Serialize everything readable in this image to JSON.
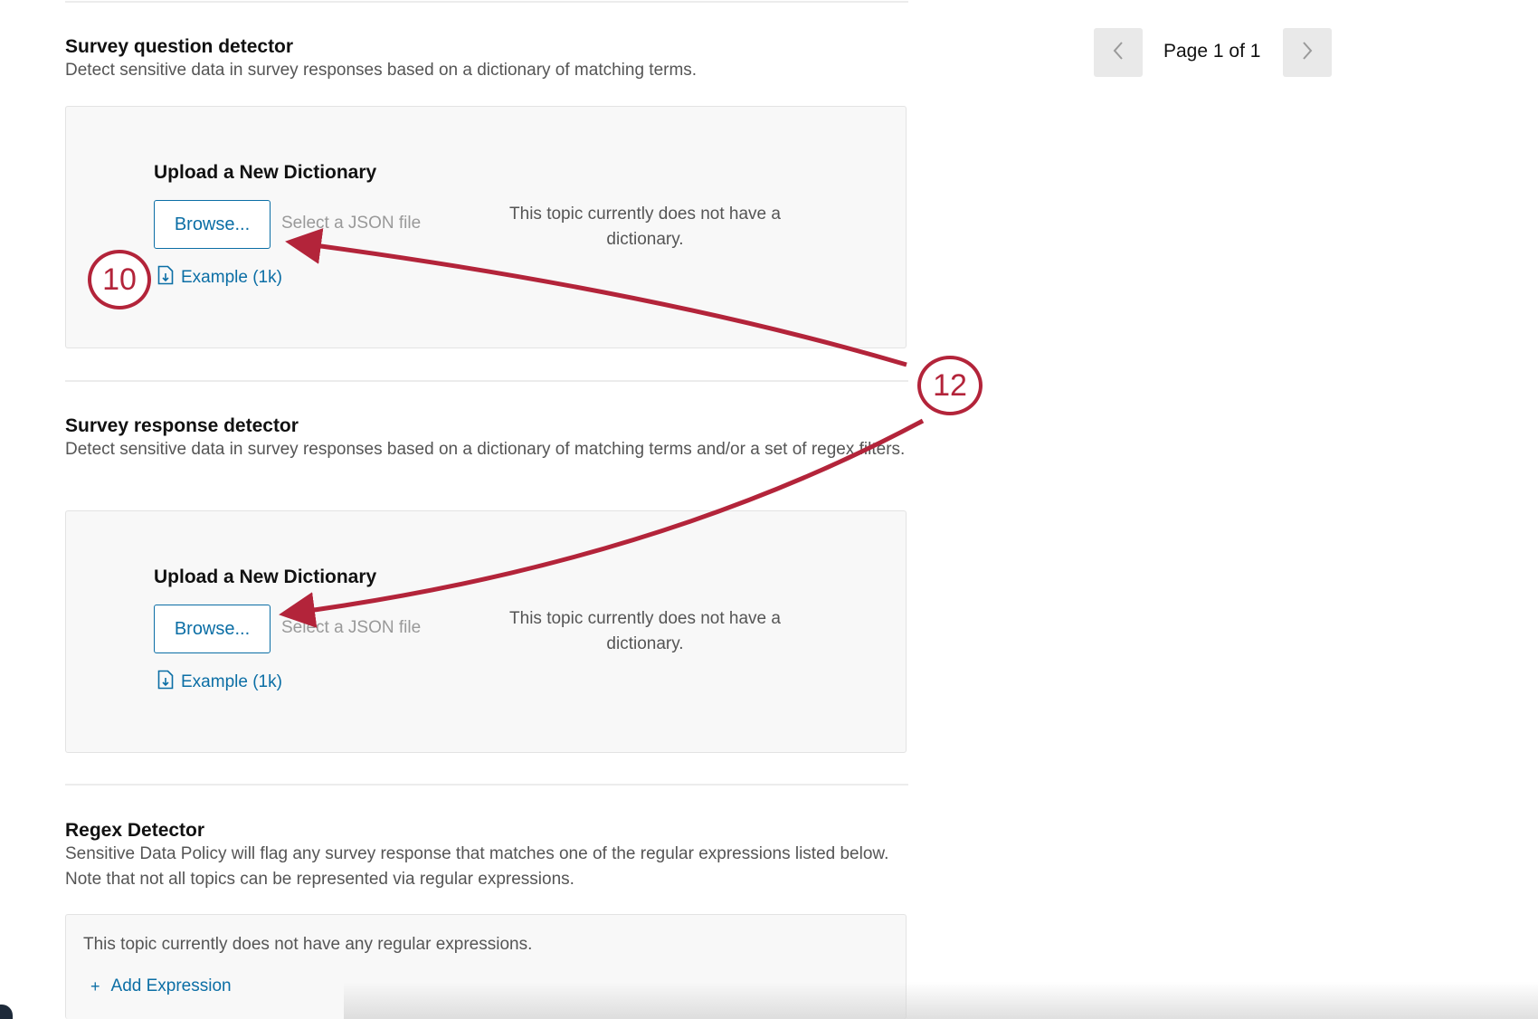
{
  "pagination": {
    "label": "Page 1 of 1",
    "prev_icon": "chevron-left-icon",
    "next_icon": "chevron-right-icon"
  },
  "question_detector": {
    "title": "Survey question detector",
    "description": "Detect sensitive data in survey responses based on a dictionary of matching terms.",
    "upload_title": "Upload a New Dictionary",
    "browse_label": "Browse...",
    "file_placeholder": "Select a JSON file",
    "no_dictionary": "This topic currently does not have a dictionary.",
    "example_link": "Example (1k)"
  },
  "response_detector": {
    "title": "Survey response detector",
    "description": "Detect sensitive data in survey responses based on a dictionary of matching terms and/or a set of regex filters.",
    "upload_title": "Upload a New Dictionary",
    "browse_label": "Browse...",
    "file_placeholder": "Select a JSON file",
    "no_dictionary": "This topic currently does not have a dictionary.",
    "example_link": "Example (1k)"
  },
  "regex_detector": {
    "title": "Regex Detector",
    "description": "Sensitive Data Policy will flag any survey response that matches one of the regular expressions listed below. Note that not all topics can be represented via regular expressions.",
    "empty_message": "This topic currently does not have any regular expressions.",
    "add_label": "Add Expression",
    "add_icon": "+"
  },
  "callouts": {
    "first": "10",
    "second": "12"
  },
  "colors": {
    "link": "#0b6ea5",
    "callout": "#b3243a",
    "panel_bg": "#f8f8f8"
  }
}
